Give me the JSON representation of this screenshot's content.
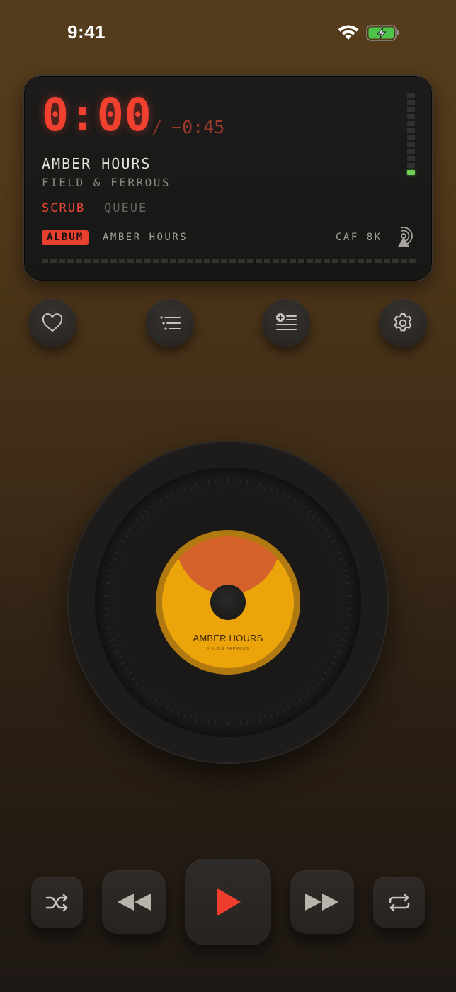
{
  "status_bar": {
    "time": "9:41"
  },
  "display": {
    "elapsed": "0:00",
    "separator": "/",
    "remaining": "−0:45",
    "track_title": "AMBER HOURS",
    "track_artist": "FIELD & FERROUS",
    "tabs": [
      {
        "label": "SCRUB",
        "active": true
      },
      {
        "label": "QUEUE",
        "active": false
      }
    ],
    "source_badge": "ALBUM",
    "source_name": "AMBER HOURS",
    "format": "CAF 8K",
    "level_meter_lit": 1,
    "progress": 0
  },
  "actions": [
    {
      "name": "favorite",
      "icon": "heart-icon"
    },
    {
      "name": "queue",
      "icon": "list-icon"
    },
    {
      "name": "add-to-queue",
      "icon": "playlist-add-icon"
    },
    {
      "name": "settings",
      "icon": "gear-icon"
    }
  ],
  "record": {
    "label_title": "AMBER HOURS",
    "label_artist": "FIELD & FERROUS",
    "label_color": "#eba40a",
    "label_accent": "#d5622a"
  },
  "transport": {
    "shuffle_icon": "shuffle-icon",
    "previous_icon": "rewind-icon",
    "play_icon": "play-icon",
    "next_icon": "fast-forward-icon",
    "repeat_icon": "repeat-icon"
  },
  "colors": {
    "accent_red": "#f04030",
    "meter_green": "#6fcf54"
  }
}
